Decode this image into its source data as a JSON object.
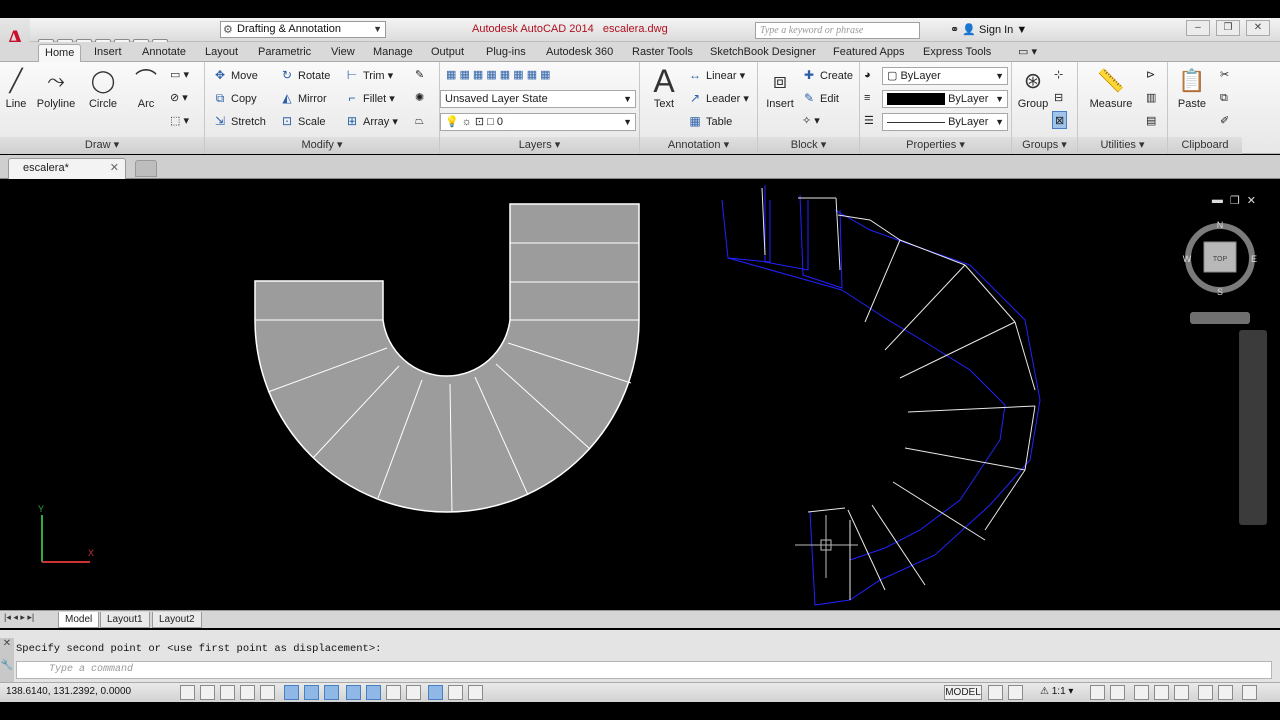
{
  "app": {
    "logo_letter": "A",
    "workspace": "Drafting & Annotation",
    "title": "Autodesk AutoCAD 2014",
    "filename": "escalera.dwg",
    "search_placeholder": "Type a keyword or phrase",
    "sign_in": "Sign In"
  },
  "tabs": [
    "Home",
    "Insert",
    "Annotate",
    "Layout",
    "Parametric",
    "View",
    "Manage",
    "Output",
    "Plug-ins",
    "Autodesk 360",
    "Raster Tools",
    "SketchBook Designer",
    "Featured Apps",
    "Express Tools"
  ],
  "ribbon": {
    "draw": {
      "title": "Draw",
      "line": "Line",
      "polyline": "Polyline",
      "circle": "Circle",
      "arc": "Arc"
    },
    "modify": {
      "title": "Modify",
      "move": "Move",
      "rotate": "Rotate",
      "trim": "Trim",
      "copy": "Copy",
      "mirror": "Mirror",
      "fillet": "Fillet",
      "stretch": "Stretch",
      "scale": "Scale",
      "array": "Array"
    },
    "layers": {
      "title": "Layers",
      "state": "Unsaved Layer State",
      "current": "0"
    },
    "annotation": {
      "title": "Annotation",
      "text": "Text",
      "linear": "Linear",
      "leader": "Leader",
      "table": "Table"
    },
    "block": {
      "title": "Block",
      "insert": "Insert",
      "create": "Create",
      "edit": "Edit"
    },
    "properties": {
      "title": "Properties",
      "color": "ByLayer",
      "lineweight": "ByLayer",
      "linetype": "ByLayer"
    },
    "groups": {
      "title": "Groups",
      "group": "Group"
    },
    "utilities": {
      "title": "Utilities",
      "measure": "Measure"
    },
    "clipboard": {
      "title": "Clipboard",
      "paste": "Paste"
    }
  },
  "document_tab": "escalera*",
  "viewcube": {
    "n": "N",
    "s": "S",
    "e": "E",
    "w": "W",
    "face": "TOP"
  },
  "layout_tabs": [
    "Model",
    "Layout1",
    "Layout2"
  ],
  "command": {
    "history": "Specify second point or <use first point as displacement>:",
    "placeholder": "Type a command"
  },
  "status": {
    "coords": "138.6140, 131.2392, 0.0000",
    "model": "MODEL",
    "scale": "1:1"
  }
}
